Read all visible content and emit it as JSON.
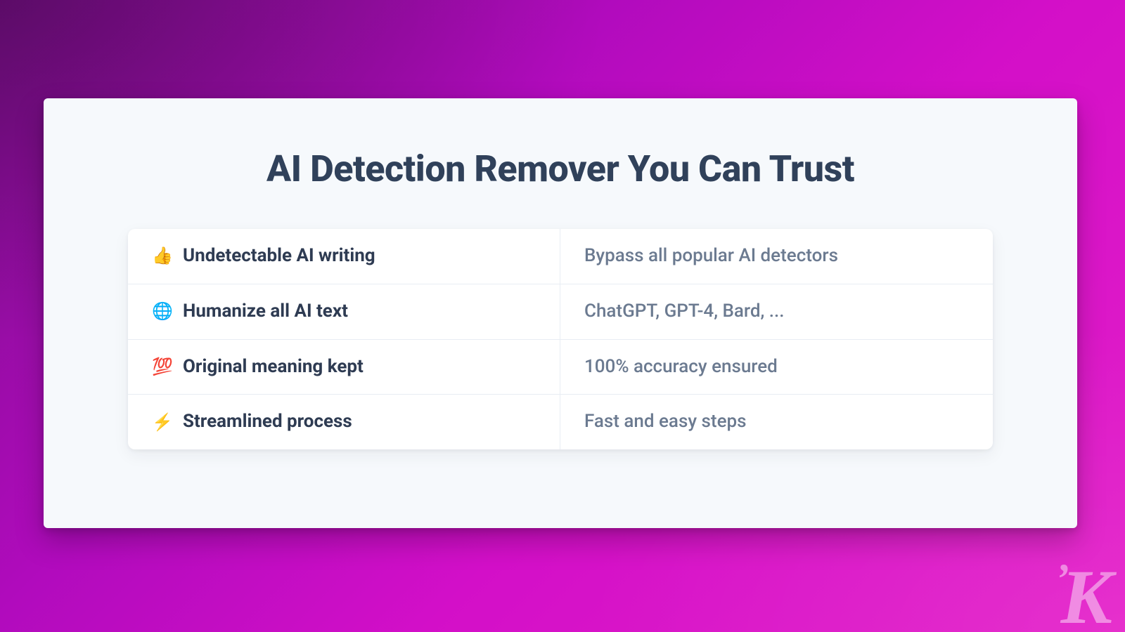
{
  "headline": "AI Detection Remover You Can Trust",
  "features": [
    {
      "icon": "👍",
      "icon_name": "thumbs-up-icon",
      "title": "Undetectable AI writing",
      "desc": "Bypass all popular AI detectors"
    },
    {
      "icon": "🌐",
      "icon_name": "globe-icon",
      "title": "Humanize all AI text",
      "desc": "ChatGPT, GPT-4, Bard, ..."
    },
    {
      "icon": "💯",
      "icon_name": "hundred-icon",
      "title": "Original meaning kept",
      "desc": "100% accuracy ensured"
    },
    {
      "icon": "⚡",
      "icon_name": "bolt-icon",
      "title": "Streamlined process",
      "desc": "Fast and easy steps"
    }
  ],
  "logo": "’K"
}
